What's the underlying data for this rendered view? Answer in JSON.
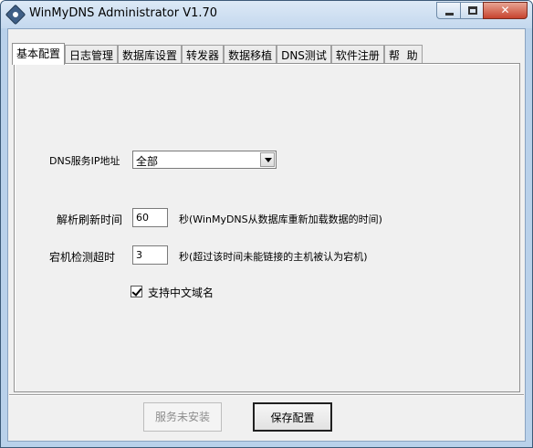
{
  "window": {
    "title": "WinMyDNS Administrator V1.70"
  },
  "tabs": [
    {
      "label": "基本配置",
      "active": true
    },
    {
      "label": "日志管理"
    },
    {
      "label": "数据库设置"
    },
    {
      "label": "转发器"
    },
    {
      "label": "数据移植"
    },
    {
      "label": "DNS测试"
    },
    {
      "label": "软件注册"
    },
    {
      "label": "帮  助"
    }
  ],
  "form": {
    "dns_ip": {
      "label": "DNS服务IP地址",
      "value": "全部"
    },
    "refresh": {
      "label": "解析刷新时间",
      "value": "60",
      "hint": "秒(WinMyDNS从数据库重新加载数据的时间)"
    },
    "timeout": {
      "label": "宕机检测超时",
      "value": "3",
      "hint": "秒(超过该时间未能链接的主机被认为宕机)"
    },
    "chinese_domain": {
      "label": "支持中文域名",
      "checked": true
    }
  },
  "buttons": {
    "service": "服务未安装",
    "save": "保存配置"
  }
}
